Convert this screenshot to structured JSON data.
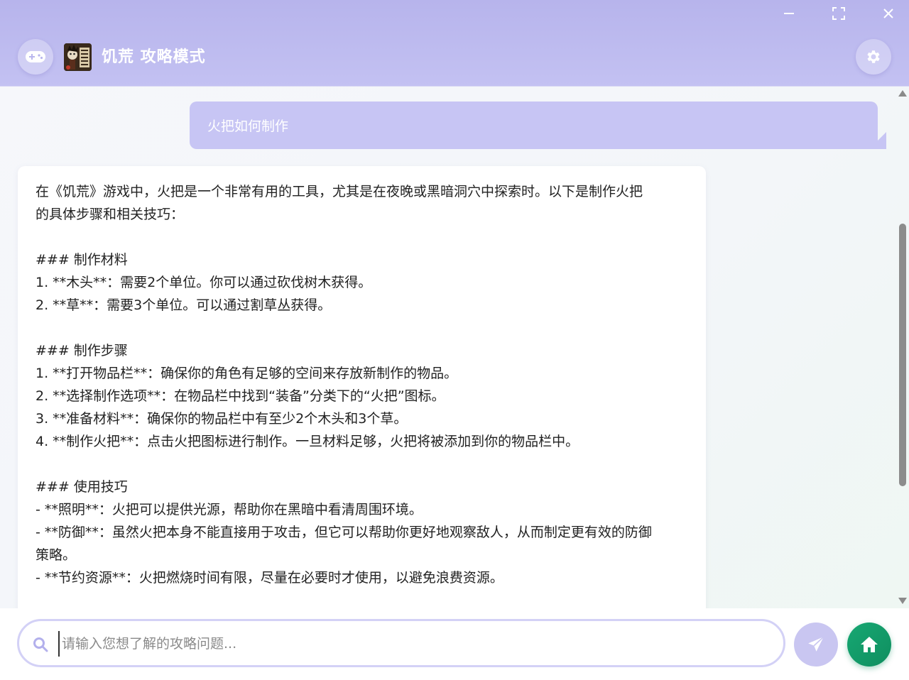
{
  "window": {
    "controls": {
      "minimize_icon": "minimize-icon",
      "maximize_icon": "fullscreen-icon",
      "close_icon": "close-icon"
    }
  },
  "header": {
    "title": "饥荒 攻略模式",
    "game_button_icon": "gamepad-icon",
    "settings_button_icon": "gear-icon"
  },
  "chat": {
    "user_message": "火把如何制作",
    "bot_message_lines": [
      "在《饥荒》游戏中，火把是一个非常有用的工具，尤其是在夜晚或黑暗洞穴中探索时。以下是制作火把",
      "的具体步骤和相关技巧：",
      "",
      "### 制作材料",
      "1. **木头**：需要2个单位。你可以通过砍伐树木获得。",
      "2. **草**：需要3个单位。可以通过割草丛获得。",
      "",
      "### 制作步骤",
      "1. **打开物品栏**：确保你的角色有足够的空间来存放新制作的物品。",
      "2. **选择制作选项**：在物品栏中找到“装备”分类下的“火把”图标。",
      "3. **准备材料**：确保你的物品栏中有至少2个木头和3个草。",
      "4. **制作火把**：点击火把图标进行制作。一旦材料足够，火把将被添加到你的物品栏中。",
      "",
      "### 使用技巧",
      "- **照明**：火把可以提供光源，帮助你在黑暗中看清周围环境。",
      "- **防御**：虽然火把本身不能直接用于攻击，但它可以帮助你更好地观察敌人，从而制定更有效的防御",
      "策略。",
      "- **节约资源**：火把燃烧时间有限，尽量在必要时才使用，以避免浪费资源。",
      ""
    ]
  },
  "input": {
    "placeholder": "请输入您想了解的攻略问题...",
    "value": "",
    "search_icon": "search-icon",
    "send_icon": "send-icon",
    "home_icon": "home-icon"
  },
  "colors": {
    "header_bg": "#b7b4ec",
    "user_bubble": "#c7c5f4",
    "home_button": "#13a06c",
    "send_button": "#c9c6f1"
  }
}
